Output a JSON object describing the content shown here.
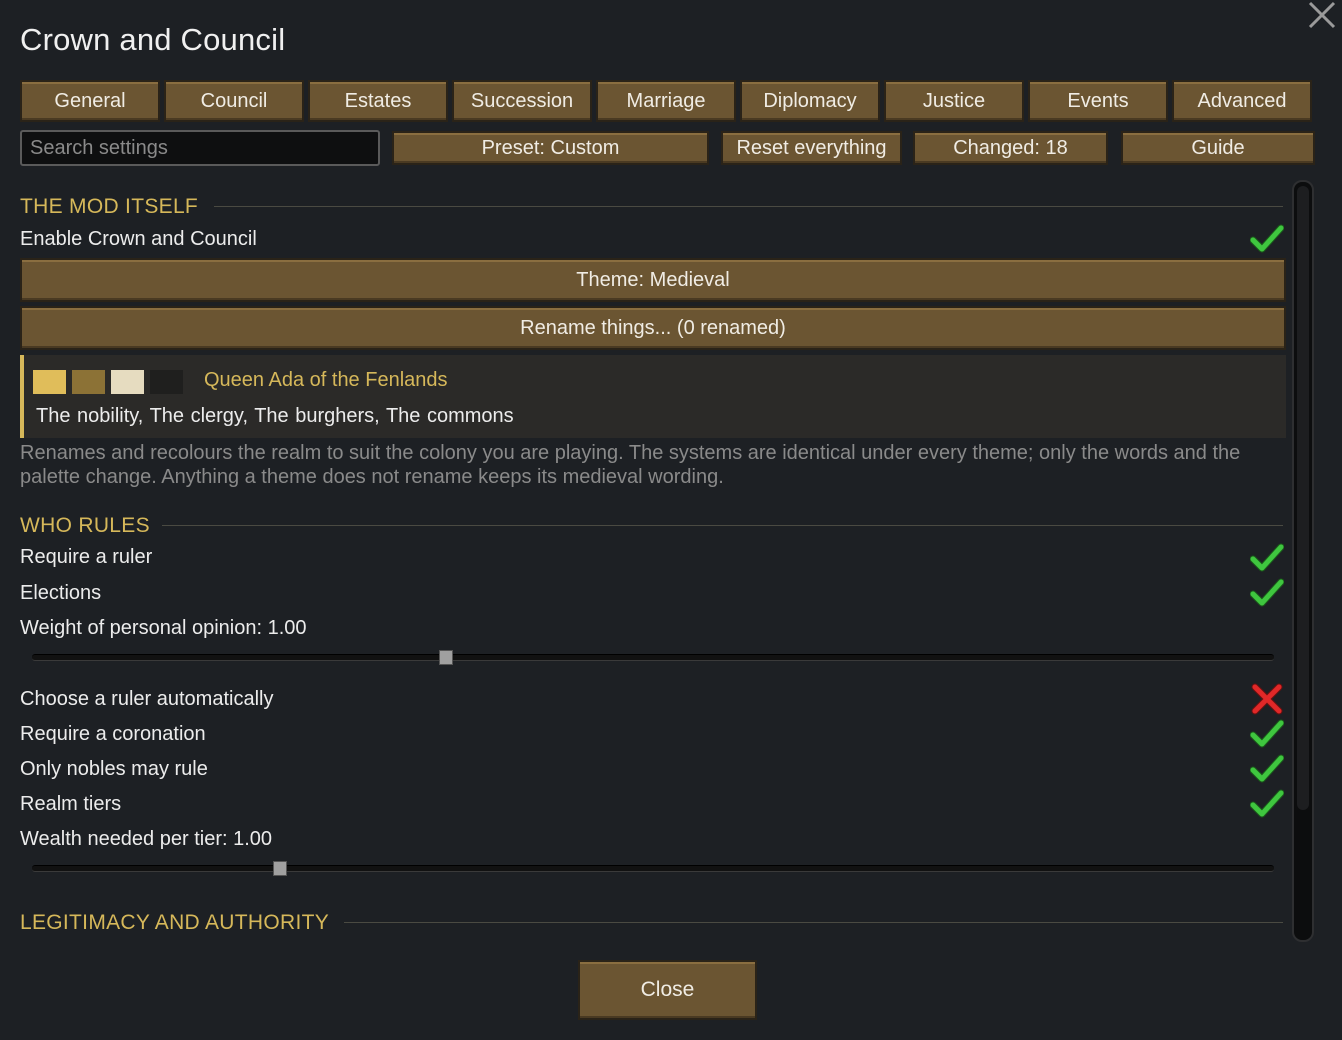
{
  "window": {
    "title": "Crown and Council",
    "close_icon": "close-x-icon"
  },
  "tabs": [
    {
      "label": "General"
    },
    {
      "label": "Council"
    },
    {
      "label": "Estates"
    },
    {
      "label": "Succession"
    },
    {
      "label": "Marriage"
    },
    {
      "label": "Diplomacy"
    },
    {
      "label": "Justice"
    },
    {
      "label": "Events"
    },
    {
      "label": "Advanced"
    }
  ],
  "toolbar": {
    "search_placeholder": "Search settings",
    "preset_label": "Preset: Custom",
    "reset_label": "Reset everything",
    "changed_label": "Changed: 18",
    "guide_label": "Guide"
  },
  "sections": {
    "mod": {
      "title": "THE MOD ITSELF",
      "enable_label": "Enable Crown and Council",
      "enable_value": true,
      "theme_button": "Theme: Medieval",
      "rename_button": "Rename things... (0 renamed)",
      "theme_preview": {
        "name": "Queen Ada of the Fenlands",
        "swatches": [
          "#e0bd5a",
          "#8c7236",
          "#e6dcc0",
          "#1f1f1e"
        ],
        "estates": [
          "The nobility,",
          "The clergy,",
          "The burghers,",
          "The commons"
        ]
      },
      "description": "Renames and recolours the realm to suit the colony you are playing. The systems are identical under every theme; only the words and the palette change. Anything a theme does not rename keeps its medieval wording."
    },
    "rules": {
      "title": "WHO RULES",
      "require_ruler": {
        "label": "Require a ruler",
        "value": true
      },
      "elections": {
        "label": "Elections",
        "value": true
      },
      "opinion_weight": {
        "label": "Weight of personal opinion: 1.00",
        "value": 1.0,
        "fraction": 0.33
      },
      "auto_ruler": {
        "label": "Choose a ruler automatically",
        "value": false
      },
      "coronation": {
        "label": "Require a coronation",
        "value": true
      },
      "nobles_only": {
        "label": "Only nobles may rule",
        "value": true
      },
      "realm_tiers": {
        "label": "Realm tiers",
        "value": true
      },
      "wealth_per_tier": {
        "label": "Wealth needed per tier: 1.00",
        "value": 1.0,
        "fraction": 0.2
      }
    },
    "legitimacy": {
      "title": "LEGITIMACY AND AUTHORITY"
    }
  },
  "footer": {
    "close_label": "Close"
  },
  "colors": {
    "background": "#1d2024",
    "button": "#6b5532",
    "section_title": "#d6b85a",
    "check_green": "#3fc63f",
    "cross_red": "#e02828"
  }
}
